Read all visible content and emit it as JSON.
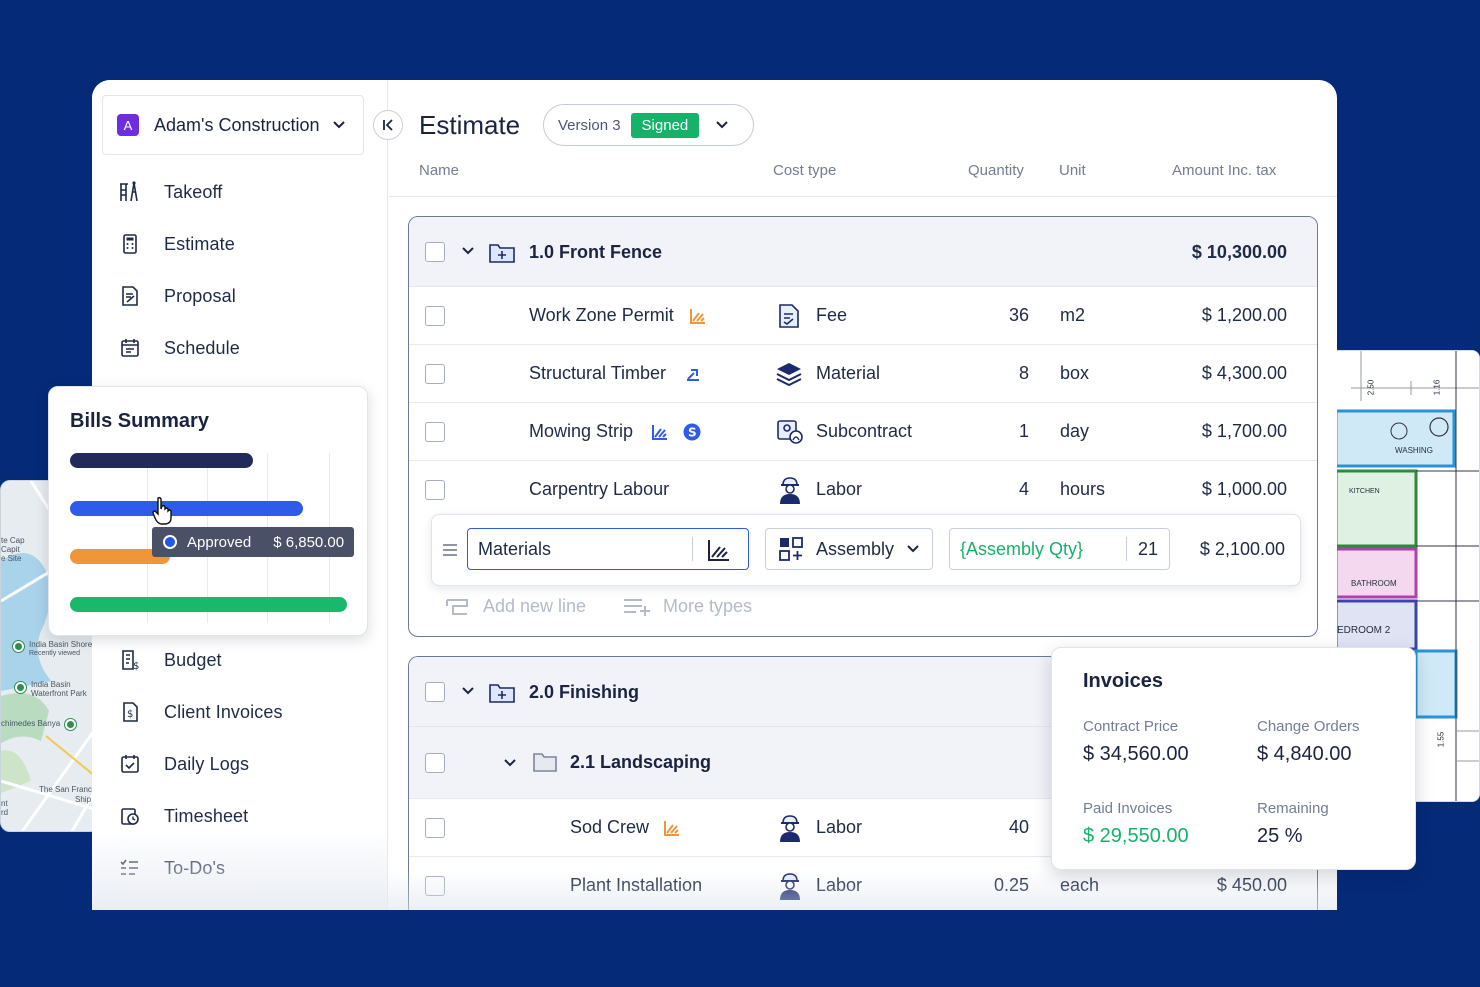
{
  "company": {
    "avatar_letter": "A",
    "name": "Adam's Construction"
  },
  "sidebar": {
    "items": [
      {
        "label": "Takeoff"
      },
      {
        "label": "Estimate"
      },
      {
        "label": "Proposal"
      },
      {
        "label": "Schedule"
      },
      {
        "label": "Budget"
      },
      {
        "label": "Client Invoices"
      },
      {
        "label": "Daily Logs"
      },
      {
        "label": "Timesheet"
      },
      {
        "label": "To-Do's"
      }
    ]
  },
  "header": {
    "title": "Estimate",
    "version": "Version 3",
    "status": "Signed"
  },
  "columns": {
    "name": "Name",
    "cost_type": "Cost type",
    "quantity": "Quantity",
    "unit": "Unit",
    "amount": "Amount Inc. tax"
  },
  "group1": {
    "title": "1.0 Front Fence",
    "amount": "$ 10,300.00",
    "rows": [
      {
        "name": "Work Zone Permit",
        "cost_type": "Fee",
        "quantity": "36",
        "unit": "m2",
        "amount": "$ 1,200.00"
      },
      {
        "name": "Structural Timber",
        "cost_type": "Material",
        "quantity": "8",
        "unit": "box",
        "amount": "$ 4,300.00"
      },
      {
        "name": "Mowing Strip",
        "cost_type": "Subcontract",
        "quantity": "1",
        "unit": "day",
        "amount": "$ 1,700.00"
      },
      {
        "name": "Carpentry Labour",
        "cost_type": "Labor",
        "quantity": "4",
        "unit": "hours",
        "amount": "$ 1,000.00"
      }
    ],
    "edit_row": {
      "name_value": "Materials",
      "cost_type": "Assembly",
      "formula": "{Assembly Qty}",
      "quantity": "21",
      "amount": "$ 2,100.00"
    },
    "add_new_line": "Add new line",
    "more_types": "More types"
  },
  "group2": {
    "title": "2.0 Finishing",
    "subgroup": "2.1 Landscaping",
    "rows": [
      {
        "name": "Sod Crew",
        "cost_type": "Labor",
        "quantity": "40"
      },
      {
        "name": "Plant Installation",
        "cost_type": "Labor",
        "quantity": "0.25",
        "unit": "each",
        "amount": "$ 450.00"
      }
    ]
  },
  "bills_summary": {
    "title": "Bills Summary",
    "tooltip_label": "Approved",
    "tooltip_value": "$ 6,850.00",
    "bars": [
      {
        "color": "#222a5c",
        "fraction": 0.66
      },
      {
        "color": "#2f5bea",
        "fraction": 0.84
      },
      {
        "color": "#f0963a",
        "fraction": 0.36
      },
      {
        "color": "#19b86b",
        "fraction": 1.0
      }
    ]
  },
  "invoices": {
    "title": "Invoices",
    "contract_price_label": "Contract Price",
    "contract_price": "$ 34,560.00",
    "change_orders_label": "Change Orders",
    "change_orders": "$ 4,840.00",
    "paid_label": "Paid Invoices",
    "paid": "$ 29,550.00",
    "remaining_label": "Remaining",
    "remaining": "25 %"
  },
  "map": {
    "labels": [
      "te Cap",
      "Capit",
      "e Site",
      "India Basin Shore",
      "Recently viewed",
      "India Basin",
      "Waterfront Park",
      "chimedes Banya",
      "The San Franc",
      "Ship",
      "nt",
      "rd"
    ]
  },
  "floor_plan": {
    "labels": [
      "2.50",
      "1.16",
      "WASHING",
      "KITCHEN",
      "BATHROOM",
      "EDROOM 2",
      "1.55"
    ]
  },
  "colors": {
    "background": "#052a78",
    "signed": "#17b26a",
    "accent_orange": "#f0963a",
    "accent_blue": "#2f5bea",
    "paid_green": "#17b26a"
  }
}
